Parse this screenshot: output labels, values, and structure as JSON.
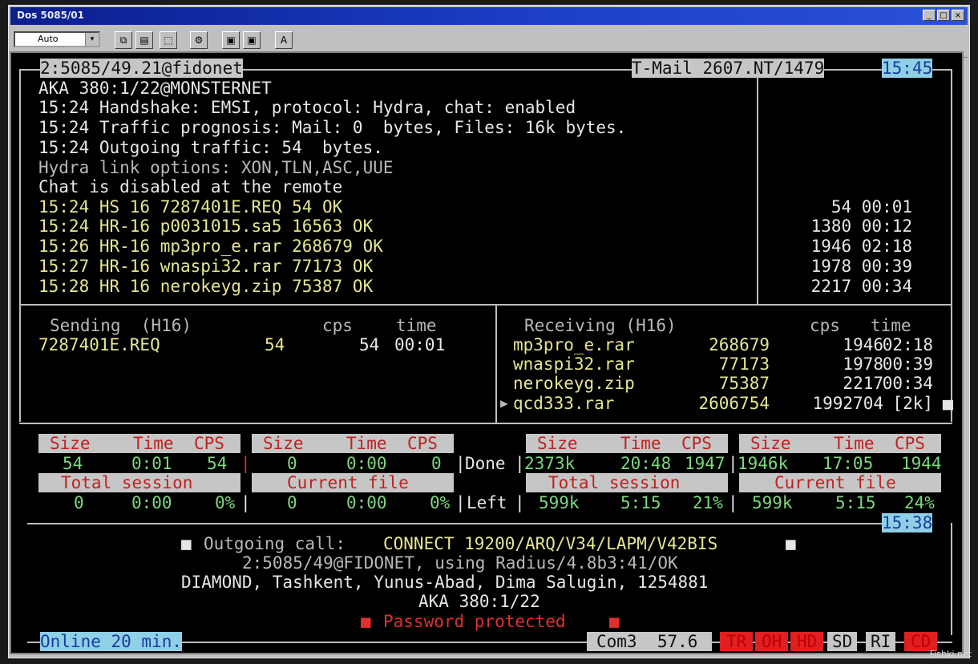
{
  "window": {
    "title": "Dos 5085/01",
    "buttons": [
      "_",
      "□",
      "×"
    ]
  },
  "toolbar": {
    "font_value": "Auto",
    "font_arrow": "▾",
    "icons": [
      "copy-icon",
      "paste-icon",
      "fullscreen-icon",
      "properties-icon",
      "background-icon",
      "font-icon"
    ],
    "icon_glyphs": [
      "⧉",
      "▤",
      "⬚",
      "⚙",
      "▣",
      "A"
    ]
  },
  "header": {
    "address": "2:5085/49.21@fidonet",
    "mailer": "T-Mail 2607.NT/1479",
    "clock": "15:45"
  },
  "log": [
    {
      "text": "AKA 380:1/22@MONSTERNET",
      "color": "w"
    },
    {
      "text": "15:24 Handshake: EMSI, protocol: Hydra, chat: enabled",
      "color": "w"
    },
    {
      "text": "15:24 Traffic prognosis: Mail: 0  bytes, Files: 16k bytes.",
      "color": "w"
    },
    {
      "text": "15:24 Outgoing traffic: 54  bytes.",
      "color": "w"
    },
    {
      "text": "Hydra link options: XON,TLN,ASC,UUE",
      "color": "gry"
    },
    {
      "text": "Chat is disabled at the remote",
      "color": "w"
    },
    {
      "text": "15:24 HS 16 7287401E.REQ 54 OK",
      "color": "y"
    },
    {
      "text": "15:24 HR-16 p0031015.sa5 16563 OK",
      "color": "y"
    },
    {
      "text": "15:26 HR-16 mp3pro_e.rar 268679 OK",
      "color": "y"
    },
    {
      "text": "15:27 HR-16 wnaspi32.rar 77173 OK",
      "color": "y"
    },
    {
      "text": "15:28 HR 16 nerokeyg.zip 75387 OK",
      "color": "y"
    }
  ],
  "side_stats": [
    "54 00:01",
    "1380 00:12",
    "1946 02:18",
    "1978 00:39",
    "2217 00:34"
  ],
  "sending": {
    "header": "Sending  (H16)",
    "cps_label": "cps",
    "time_label": "time",
    "rows": [
      {
        "name": "7287401E.REQ",
        "size": "54",
        "cps": "54",
        "time": "00:01"
      }
    ]
  },
  "receiving": {
    "header": "Receiving (H16)",
    "cps_label": "cps",
    "time_label": "time",
    "rows": [
      {
        "name": "mp3pro_e.rar",
        "size": "268679",
        "cps": "1946",
        "time": "02:18"
      },
      {
        "name": "wnaspi32.rar",
        "size": "77173",
        "cps": "1978",
        "time": "00:39"
      },
      {
        "name": "nerokeyg.zip",
        "size": "75387",
        "cps": "2217",
        "time": "00:34"
      },
      {
        "name": "qcd333.rar",
        "size": "2606754",
        "cps": "1992704",
        "time": "[2k]"
      }
    ],
    "cursor": "▶"
  },
  "stats": {
    "col_size": "Size",
    "col_time": "Time",
    "col_cps": "CPS",
    "total_label": "Total session",
    "current_label": "Current file",
    "done_label": "Done",
    "left_label": "Left",
    "send_total_done": {
      "size": "54",
      "time": "0:01",
      "cps": "54"
    },
    "send_current_done": {
      "size": "0",
      "time": "0:00",
      "cps": "0"
    },
    "send_total_left": {
      "size": "0",
      "time": "0:00",
      "pct": "0%"
    },
    "send_current_left": {
      "size": "0",
      "time": "0:00",
      "pct": "0%"
    },
    "recv_total_done": {
      "size": "2373k",
      "time": "20:48",
      "cps": "1947"
    },
    "recv_current_done": {
      "size": "1946k",
      "time": "17:05",
      "cps": "1944"
    },
    "recv_total_left": {
      "size": "599k",
      "time": "5:15",
      "pct": "21%"
    },
    "recv_current_left": {
      "size": "599k",
      "time": "5:15",
      "pct": "24%"
    }
  },
  "call": {
    "clock": "15:38",
    "bullet": "■",
    "label": "Outgoing call:",
    "connect": "CONNECT 19200/ARQ/V34/LAPM/V42BIS",
    "address_line": "2:5085/49@FIDONET, using Radius/4.8b3:41/OK",
    "sysop_line": "DIAMOND, Tashkent, Yunus-Abad, Dima Salugin, 1254881",
    "aka_line": "AKA 380:1/22",
    "password": "Password protected"
  },
  "status": {
    "online": "Online 20 min.",
    "port": "Com3  57.6",
    "indicators": [
      "TR",
      "OH",
      "HD"
    ],
    "sd": "SD",
    "ri": "RI",
    "cd": "CD"
  },
  "watermark": "Fishki.net"
}
